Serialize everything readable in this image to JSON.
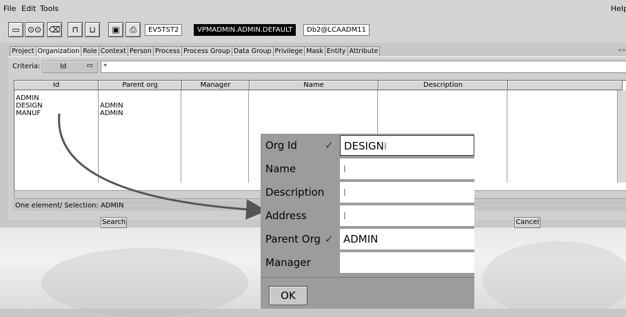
{
  "menu": {
    "file": "File",
    "edit": "Edit",
    "tools": "Tools",
    "help": "Help"
  },
  "toolbar": {
    "fields": [
      "EV5TST2",
      "VPMADMIN.ADMIN.DEFAULT",
      "Db2@LCAADM11"
    ]
  },
  "tabs": [
    "Project",
    "Organization",
    "Role",
    "Context",
    "Person",
    "Process",
    "Process Group",
    "Data Group",
    "Privilege",
    "Mask",
    "Entity",
    "Attribute"
  ],
  "criteria": {
    "label": "Criteria:",
    "field": "Id",
    "value": "*"
  },
  "table": {
    "headers": [
      "Id",
      "Parent org",
      "Manager",
      "Name",
      "Description"
    ],
    "rows": [
      {
        "id": "ADMIN",
        "parent": ""
      },
      {
        "id": "DESIGN",
        "parent": "ADMIN"
      },
      {
        "id": "MANUF",
        "parent": "ADMIN"
      }
    ]
  },
  "status": "One element/ Selection: ADMIN",
  "buttons": {
    "search": "Search",
    "cancel": "Cancel"
  },
  "form": {
    "fields": [
      {
        "label": "Org Id",
        "checked": true,
        "value": "DESIGN"
      },
      {
        "label": "Name",
        "checked": false,
        "value": ""
      },
      {
        "label": "Description",
        "checked": false,
        "value": ""
      },
      {
        "label": "Address",
        "checked": false,
        "value": ""
      },
      {
        "label": "Parent Org",
        "checked": true,
        "value": "ADMIN"
      },
      {
        "label": "Manager",
        "checked": false,
        "value": ""
      }
    ],
    "ok": "OK",
    "check_glyph": "✓"
  }
}
